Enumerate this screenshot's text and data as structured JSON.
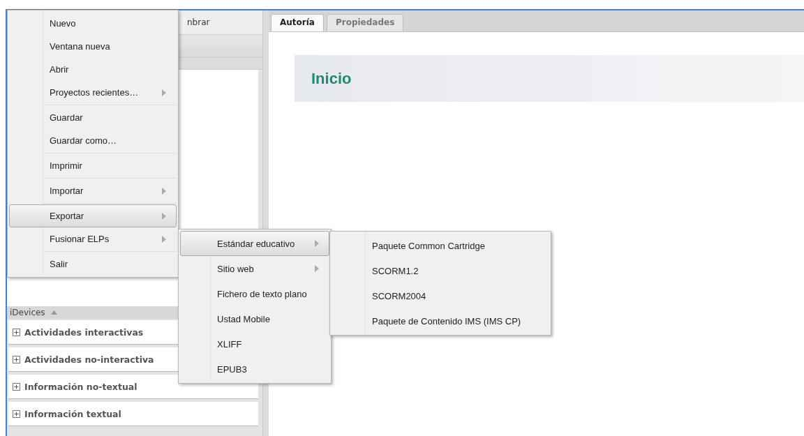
{
  "left_panel": {
    "toolbar_text": "nbrar",
    "idevices": {
      "label": "iDevices",
      "expanded": true
    },
    "categories": [
      {
        "label": "Actividades interactivas",
        "expanded": false
      },
      {
        "label": "Actividades no-interactiva",
        "expanded": false
      },
      {
        "label": "Información no-textual",
        "expanded": false
      },
      {
        "label": "Información textual",
        "expanded": false
      }
    ]
  },
  "editor": {
    "tabs": [
      {
        "label": "Autoría",
        "selected": true
      },
      {
        "label": "Propiedades",
        "selected": false
      }
    ],
    "page_title": "Inicio"
  },
  "menus": [
    {
      "items": [
        {
          "kind": "item",
          "label": "Nuevo",
          "submenu": false,
          "selected": false
        },
        {
          "kind": "item",
          "label": "Ventana nueva",
          "submenu": false,
          "selected": false
        },
        {
          "kind": "item",
          "label": "Abrir",
          "submenu": false,
          "selected": false
        },
        {
          "kind": "item",
          "label": "Proyectos recientes…",
          "submenu": true,
          "selected": false
        },
        {
          "kind": "separator"
        },
        {
          "kind": "item",
          "label": "Guardar",
          "submenu": false,
          "selected": false
        },
        {
          "kind": "item",
          "label": "Guardar como…",
          "submenu": false,
          "selected": false
        },
        {
          "kind": "separator"
        },
        {
          "kind": "item",
          "label": "Imprimir",
          "submenu": false,
          "selected": false
        },
        {
          "kind": "separator"
        },
        {
          "kind": "item",
          "label": "Importar",
          "submenu": true,
          "selected": false
        },
        {
          "kind": "separator"
        },
        {
          "kind": "item",
          "label": "Exportar",
          "submenu": true,
          "selected": true
        },
        {
          "kind": "item",
          "label": "Fusionar ELPs",
          "submenu": true,
          "selected": false
        },
        {
          "kind": "separator"
        },
        {
          "kind": "item",
          "label": "Salir",
          "submenu": false,
          "selected": false
        }
      ]
    },
    {
      "items": [
        {
          "kind": "item",
          "label": "Estándar educativo",
          "submenu": true,
          "selected": true
        },
        {
          "kind": "item",
          "label": "Sitio web",
          "submenu": true,
          "selected": false
        },
        {
          "kind": "item",
          "label": "Fichero de texto plano",
          "submenu": false,
          "selected": false
        },
        {
          "kind": "item",
          "label": "Ustad Mobile",
          "submenu": false,
          "selected": false
        },
        {
          "kind": "item",
          "label": "XLIFF",
          "submenu": false,
          "selected": false
        },
        {
          "kind": "item",
          "label": "EPUB3",
          "submenu": false,
          "selected": false
        }
      ]
    },
    {
      "items": [
        {
          "kind": "item",
          "label": "Paquete Common Cartridge",
          "submenu": false,
          "selected": false
        },
        {
          "kind": "item",
          "label": "SCORM1.2",
          "submenu": false,
          "selected": false
        },
        {
          "kind": "item",
          "label": "SCORM2004",
          "submenu": false,
          "selected": false
        },
        {
          "kind": "item",
          "label": "Paquete de Contenido IMS (IMS CP)",
          "submenu": false,
          "selected": false
        }
      ]
    }
  ]
}
